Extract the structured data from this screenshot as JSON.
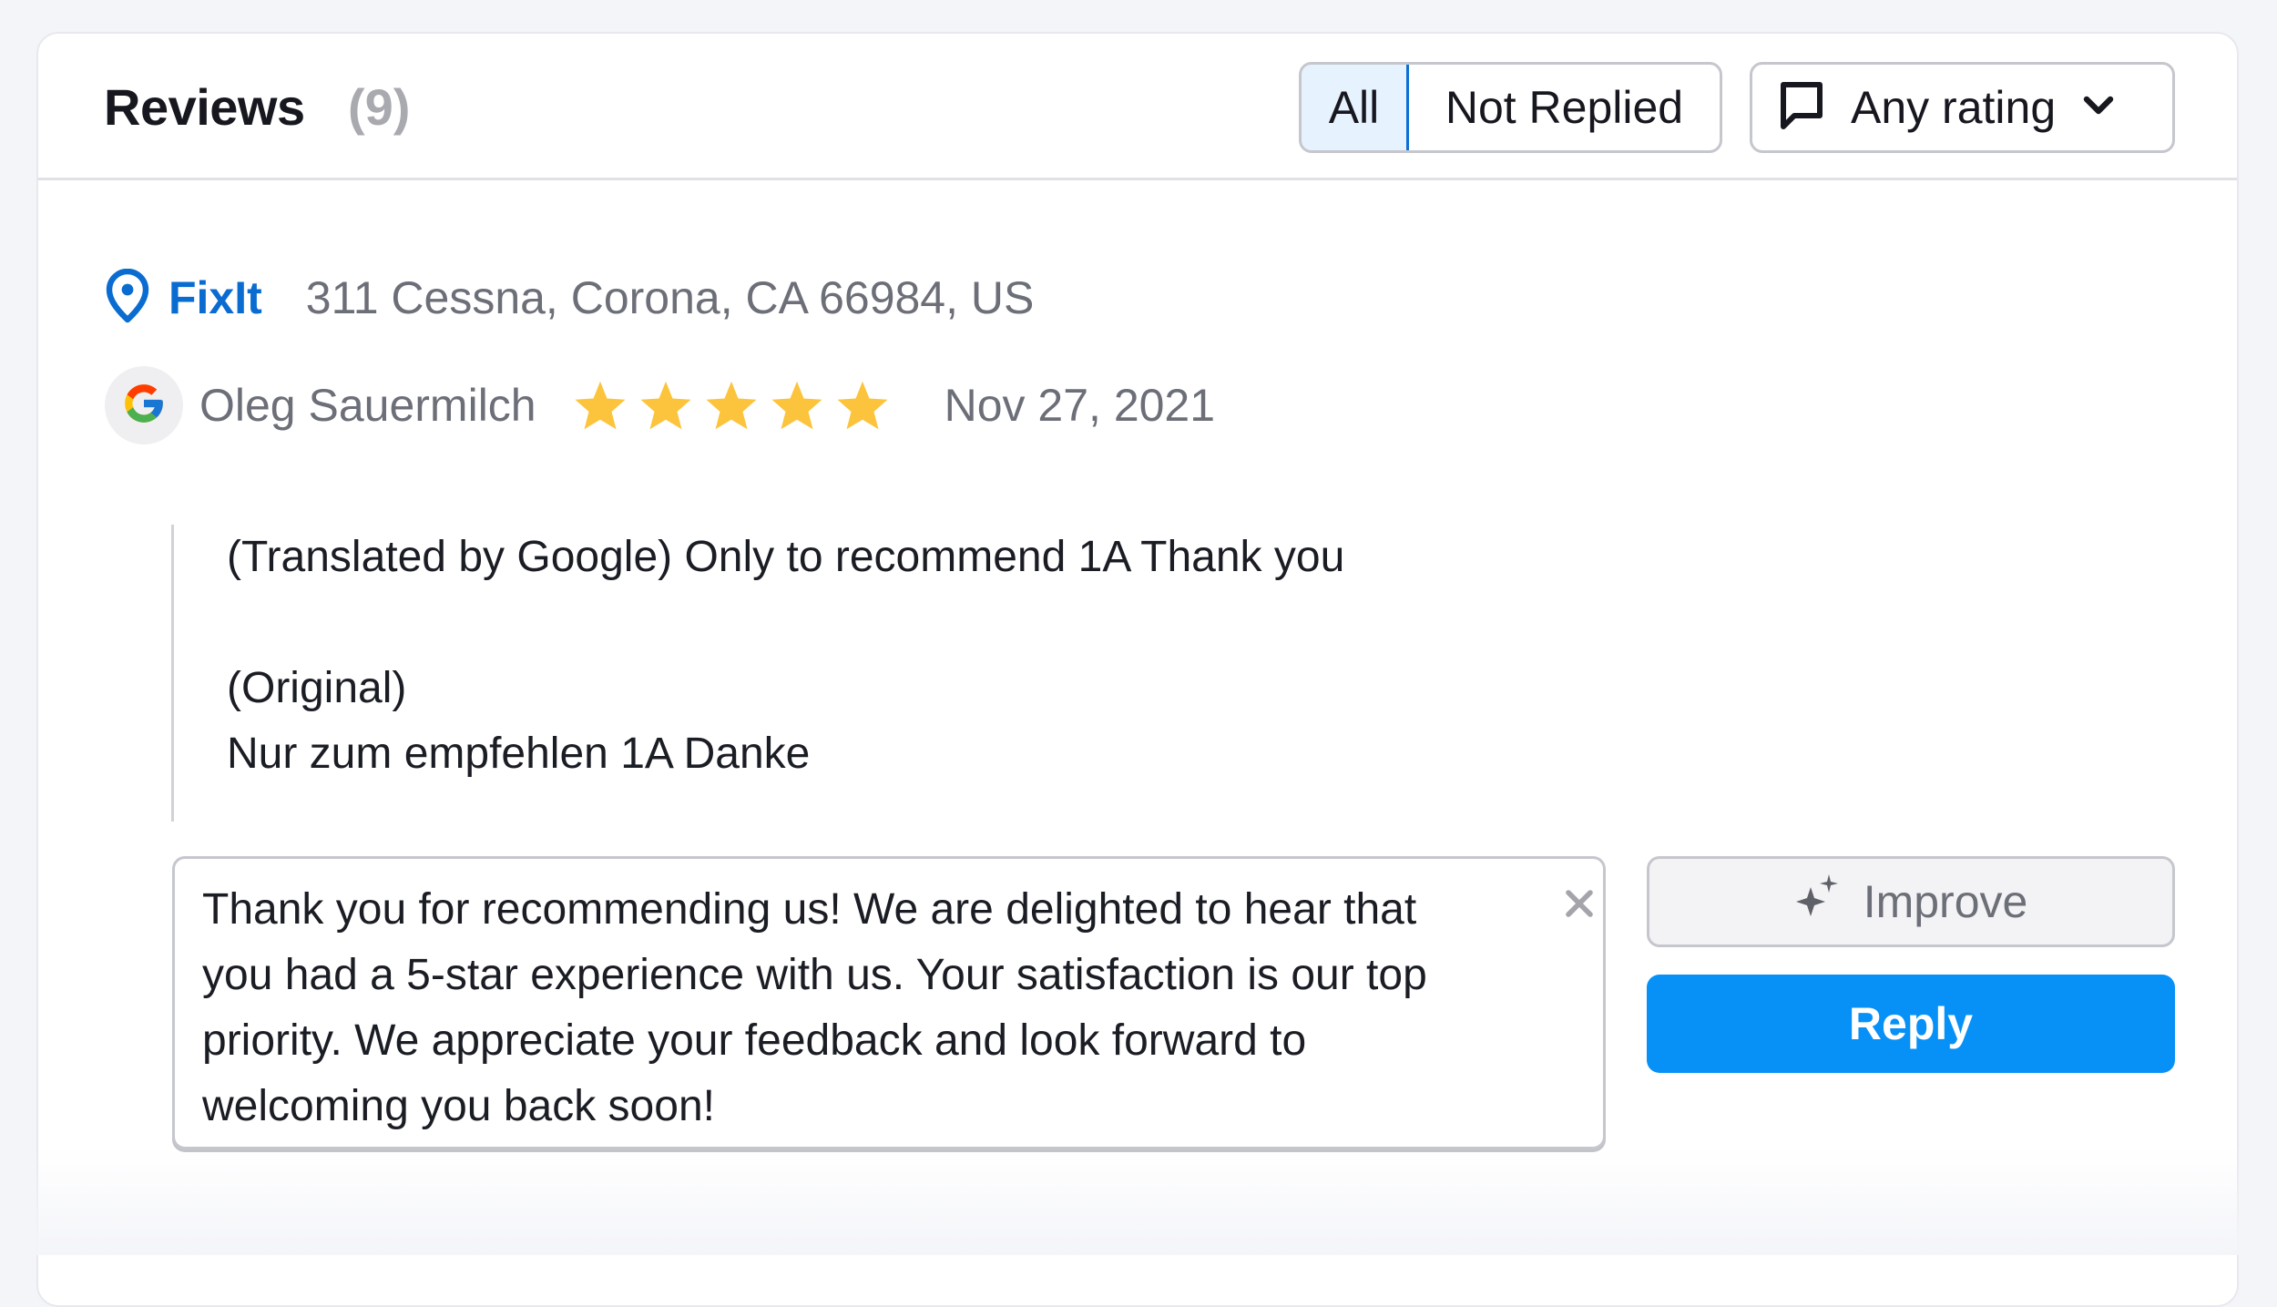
{
  "header": {
    "title": "Reviews",
    "count": "(9)",
    "filters": [
      {
        "label": "All",
        "selected": true
      },
      {
        "label": "Not Replied",
        "selected": false
      }
    ],
    "rating_filter": {
      "icon": "speech-bubble-icon",
      "label": "Any rating"
    }
  },
  "review": {
    "business_name": "FixIt",
    "address": "311 Cessna, Corona, CA 66984, US",
    "source_icon": "google-icon",
    "author": "Oleg Sauermilch",
    "rating": 5,
    "rating_max": 5,
    "date": "Nov 27, 2021",
    "text_translated": "(Translated by Google) Only to recommend 1A Thank you",
    "text_original_label": "(Original)",
    "text_original": "Nur zum empfehlen 1A Danke"
  },
  "reply": {
    "value": "Thank you for recommending us! We are delighted to hear that you had a 5-star experience with us. Your satisfaction is our top priority. We appreciate your feedback and look forward to welcoming you back soon!",
    "improve_label": "Improve",
    "reply_label": "Reply"
  },
  "colors": {
    "accent": "#0791f7",
    "brand_link": "#0a6cd0",
    "star": "#fcc43c",
    "selected_bg": "#e6f2fd"
  }
}
